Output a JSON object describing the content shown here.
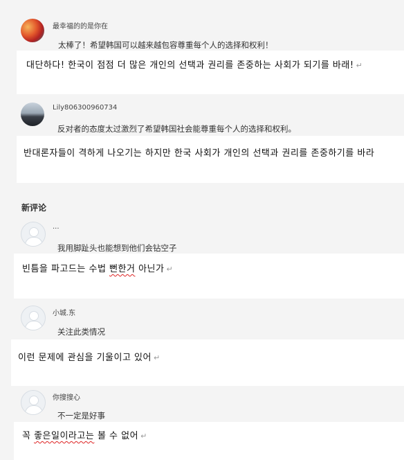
{
  "top_comments": [
    {
      "username": "最幸福的的是你在",
      "text": "太棒了！希望韩国可以越来越包容尊重每个人的选择和权利！",
      "reply": "대단하다! 한국이 점점 더 많은 개인의 선택과 권리를 존중하는 사회가 되기를 바래!",
      "avatar_icon": "sunset-avatar-icon"
    },
    {
      "username": "Lily806300960734",
      "text": "反对者的态度太过激烈了希望韩国社会能尊重每个人的选择和权利。",
      "reply": "반대론자들이 격하게 나오기는 하지만 한국 사회가 개인의 선택과 권리를 존중하기를 바라",
      "avatar_icon": "mountain-avatar-icon"
    }
  ],
  "new_comments_title": "新评论",
  "new_comments": [
    {
      "username": "...",
      "text": "我用脚趾头也能想到他们会钻空子",
      "reply_before": "빈틈을 파고드는 수법 ",
      "reply_marked": "뻔한거",
      "reply_after": " 아닌가",
      "avatar_icon": "default-avatar-icon"
    },
    {
      "username": "小城.东",
      "text": "关注此类情况",
      "reply_before": "이런 문제에 관심을 기울이고 있어",
      "reply_marked": "",
      "reply_after": "",
      "avatar_icon": "default-avatar-icon"
    },
    {
      "username": "你搜搜心",
      "text": "不一定是好事",
      "reply_before": "꼭 ",
      "reply_marked": "좋은일이라고는",
      "reply_after": " 볼 수 없어",
      "avatar_icon": "default-avatar-icon"
    }
  ],
  "paragraph_mark": "↵"
}
